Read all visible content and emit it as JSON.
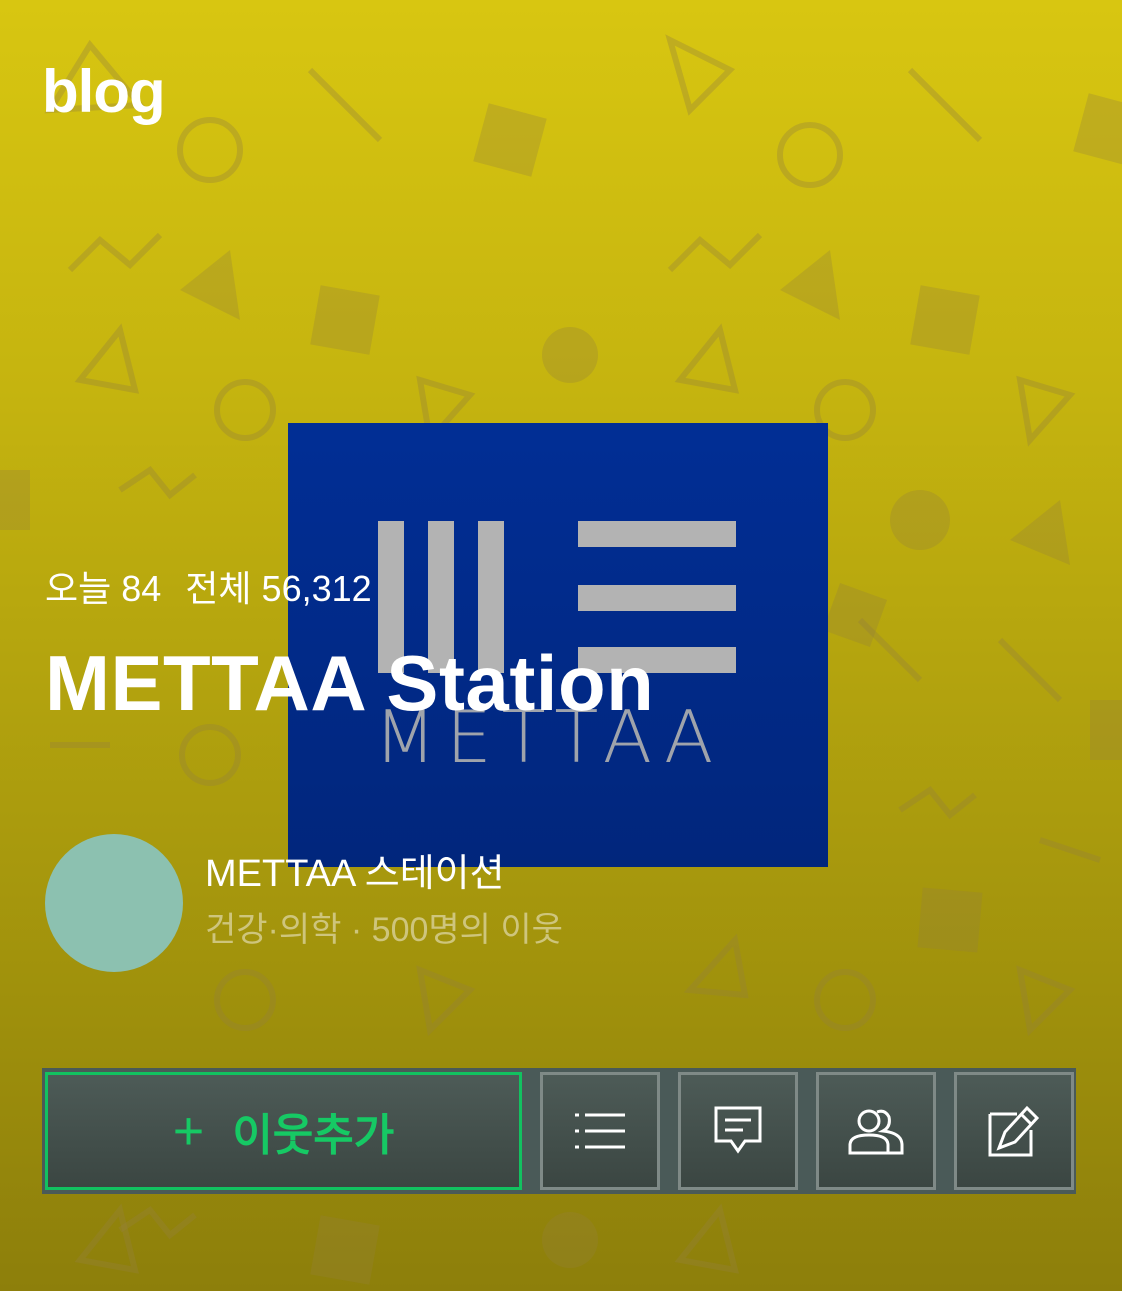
{
  "header": {
    "logo_text": "blog"
  },
  "cover": {
    "brand_text": "METTAA",
    "bg_color": "#012e95"
  },
  "stats": {
    "today_label": "오늘",
    "today_value": "84",
    "total_label": "전체",
    "total_value": "56,312"
  },
  "blog": {
    "title": "METTAA Station"
  },
  "owner": {
    "name": "METTAA 스테이션",
    "meta": "건강·의학 · 500명의 이웃",
    "avatar_color": "#8cc1b0"
  },
  "actions": {
    "add_neighbor_label": "이웃추가",
    "add_neighbor_icon": "plus-icon",
    "icons": [
      "list-icon",
      "comment-icon",
      "neighbors-icon",
      "write-icon"
    ]
  },
  "colors": {
    "accent": "#16c964",
    "background_top": "#d8c611",
    "background_bottom": "#8d7f0b"
  }
}
